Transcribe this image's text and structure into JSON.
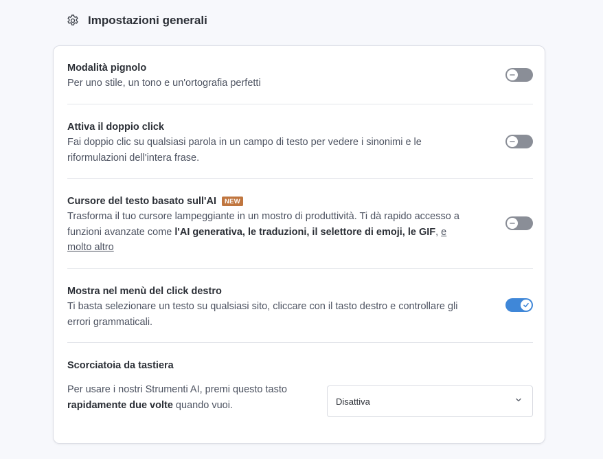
{
  "header": {
    "title": "Impostazioni generali",
    "icon": "gear-icon"
  },
  "settings": [
    {
      "title": "Modalità pignolo",
      "description": "Per uno stile, un tono e un'ortografia perfetti",
      "enabled": false
    },
    {
      "title": "Attiva il doppio click",
      "description": "Fai doppio clic su qualsiasi parola in un campo di testo per vedere i sinonimi e le riformulazioni dell'intera frase.",
      "enabled": false
    },
    {
      "title": "Cursore del testo basato sull'AI",
      "badge": "NEW",
      "description_start": "Trasforma il tuo cursore lampeggiante in un mostro di produttività. Ti dà rapido accesso a funzioni avanzate come ",
      "description_bold": "l'AI generativa, le traduzioni, il selettore di emoji, le GIF",
      "description_comma": ",",
      "description_link": "e molto altro",
      "enabled": false
    },
    {
      "title": "Mostra nel menù del click destro",
      "description": "Ti basta selezionare un testo su qualsiasi sito, cliccare con il tasto destro e controllare gli errori grammaticali.",
      "enabled": true
    }
  ],
  "shortcut": {
    "title": "Scorciatoia da tastiera",
    "description_start": "Per usare i nostri Strumenti AI, premi questo tasto ",
    "description_bold": "rapidamente due volte",
    "description_end": " quando vuoi.",
    "selected": "Disattiva"
  },
  "colors": {
    "toggle_off": "#8a8e97",
    "toggle_on": "#3f87d8",
    "badge": "#c0763f"
  }
}
